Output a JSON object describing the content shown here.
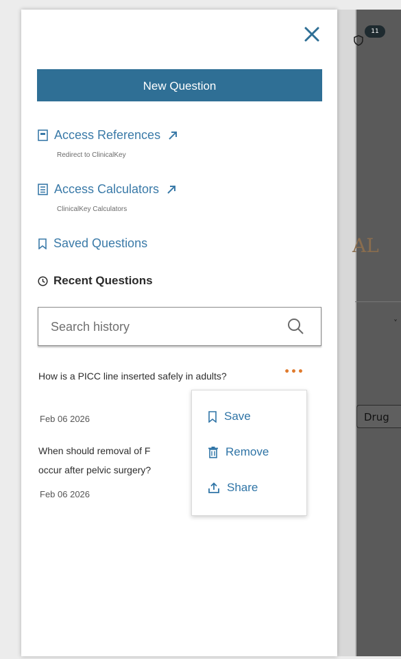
{
  "drawer": {
    "close_icon": "close-icon",
    "new_question_label": "New Question",
    "nav": [
      {
        "label": "Access References",
        "subtitle": "Redirect to ClinicalKey",
        "icon": "book-icon"
      },
      {
        "label": "Access Calculators",
        "subtitle": "ClinicalKey Calculators",
        "icon": "calculator-icon"
      },
      {
        "label": "Saved Questions",
        "icon": "bookmark-icon"
      }
    ],
    "recent_heading": "Recent Questions",
    "search": {
      "placeholder": "Search history",
      "value": ""
    },
    "history": [
      {
        "question": "How is a PICC line inserted safely in adults?",
        "date": "Feb 06 2026"
      },
      {
        "question": "When should removal of F",
        "question_line2": "occur after pelvic surgery?",
        "date": "Feb 06 2026"
      }
    ],
    "more_label": "•••",
    "menu": [
      {
        "label": "Save",
        "icon": "bookmark-icon"
      },
      {
        "label": "Remove",
        "icon": "trash-icon"
      },
      {
        "label": "Share",
        "icon": "share-icon"
      }
    ]
  },
  "background": {
    "badge_text": "11",
    "partial_letter": "AL",
    "drug_label": "Drug"
  },
  "colors": {
    "primary": "#2f6f95",
    "link": "#3a7aa8",
    "accent": "#e07b2e"
  }
}
